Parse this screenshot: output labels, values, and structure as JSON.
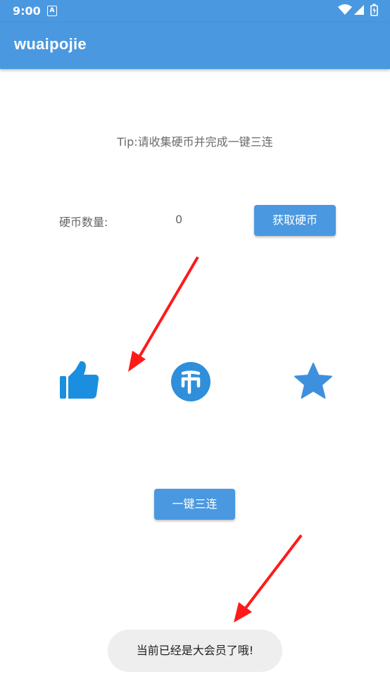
{
  "status_bar": {
    "time": "9:00",
    "notification_icon": "A"
  },
  "app_bar": {
    "title": "wuaipojie"
  },
  "main": {
    "tip": "Tip:请收集硬币并完成一键三连",
    "coin_label": "硬币数量:",
    "coin_count": "0",
    "get_coins_button": "获取硬币",
    "icons": [
      "thumbs-up-icon",
      "coin-icon",
      "star-icon"
    ],
    "triple_button": "一键三连"
  },
  "toast": {
    "message": "当前已经是大会员了哦!"
  },
  "colors": {
    "primary": "#4a98e0",
    "like_icon": "#1a8fdf",
    "coin_icon": "#2f8fdb",
    "star_icon": "#3f90dc",
    "arrow": "#ff1a1a"
  }
}
